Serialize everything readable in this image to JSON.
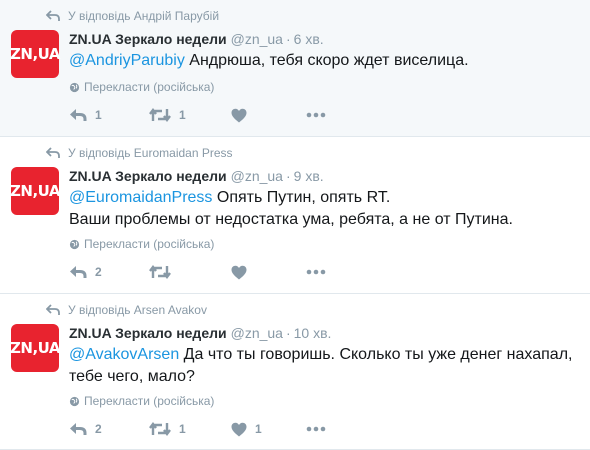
{
  "colors": {
    "accent": "#1b95e0",
    "muted": "#8899a6",
    "avatar": "#e8232f"
  },
  "tweets": [
    {
      "reply_context": "У відповідь Андрій Парубій",
      "avatar_text": "ZN,UA",
      "name": "ZN.UA Зеркало недели",
      "handle": "@zn_ua",
      "dot": "·",
      "time": "6 хв.",
      "mention": "@AndriyParubiy",
      "text": " Андрюша, тебя скоро ждет виселица.",
      "text2": "",
      "translate": "Перекласти (російська)",
      "reply_count": "1",
      "retweet_count": "1",
      "like_count": ""
    },
    {
      "reply_context": "У відповідь Euromaidan Press",
      "avatar_text": "ZN,UA",
      "name": "ZN.UA Зеркало недели",
      "handle": "@zn_ua",
      "dot": "·",
      "time": "9 хв.",
      "mention": "@EuromaidanPress",
      "text": " Опять Путин, опять RT.",
      "text2": "Ваши проблемы от недостатка ума, ребята, а не от Путина.",
      "translate": "Перекласти (російська)",
      "reply_count": "2",
      "retweet_count": "",
      "like_count": ""
    },
    {
      "reply_context": "У відповідь Arsen Avakov",
      "avatar_text": "ZN,UA",
      "name": "ZN.UA Зеркало недели",
      "handle": "@zn_ua",
      "dot": "·",
      "time": "10 хв.",
      "mention": "@AvakovArsen",
      "text": " Да что ты говоришь. Сколько ты уже денег нахапал,",
      "text2": "тебе чего, мало?",
      "translate": "Перекласти (російська)",
      "reply_count": "2",
      "retweet_count": "1",
      "like_count": "1"
    }
  ]
}
